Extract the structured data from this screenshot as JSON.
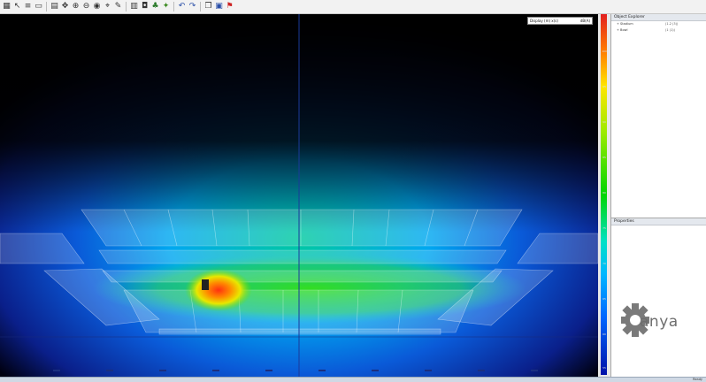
{
  "toolbar": {
    "icons": [
      "grid-icon",
      "cursor-icon",
      "layers-icon",
      "window-icon",
      "printer-icon",
      "move-icon",
      "zoom-in-icon",
      "zoom-out-icon",
      "eye-icon",
      "measure-icon",
      "pen-icon",
      "chart-icon",
      "camera-icon",
      "paint-icon",
      "sun-icon",
      "undo-icon",
      "redo-icon",
      "copy-icon",
      "save-icon",
      "flag-icon"
    ]
  },
  "viewport": {
    "display_label": "Display (m) x(s)",
    "display_value": "dB(A)"
  },
  "colors": {
    "background": "#000000",
    "scale_top": "#e22020",
    "scale_bottom": "#0012a8",
    "accent": "#e84018"
  },
  "color_scale": {
    "ticks": [
      "100",
      "95",
      "90",
      "85",
      "80",
      "75",
      "70",
      "65",
      "60",
      "55"
    ]
  },
  "object_explorer": {
    "title": "Object Explorer",
    "rows": [
      {
        "name": "+ Stadium",
        "value": "(1.2 (3))"
      },
      {
        "name": "+ Bowl",
        "value": "(1 (1))"
      }
    ]
  },
  "properties": {
    "title": "Properties"
  },
  "logo": {
    "text": "anya",
    "icon": "gear-icon"
  },
  "statusbar": {
    "text": "Ready"
  }
}
